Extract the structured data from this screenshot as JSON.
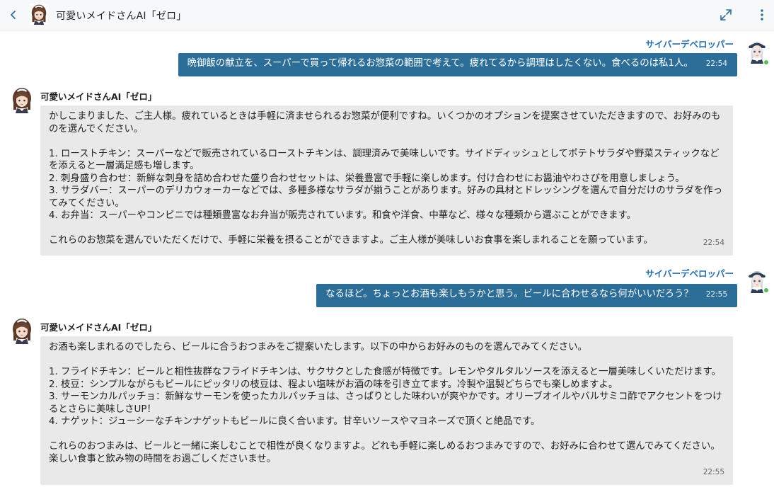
{
  "header": {
    "title": "可愛いメイドさんAI「ゼロ」"
  },
  "user": {
    "name": "サイバーデベロッパー"
  },
  "ai": {
    "name": "可愛いメイドさんAI「ゼロ」"
  },
  "messages": [
    {
      "text": "晩御飯の献立を、スーパーで買って帰れるお惣菜の範囲で考えて。疲れてるから調理はしたくない。食べるのは私1人。",
      "time": "22:54"
    },
    {
      "lines": [
        "かしこまりました、ご主人様。疲れているときは手軽に済ませられるお惣菜が便利ですね。いくつかのオプションを提案させていただきますので、お好みのものを選んでください。",
        "",
        "1. ローストチキン：スーパーなどで販売されているローストチキンは、調理済みで美味しいです。サイドディッシュとしてポテトサラダや野菜スティックなどを添えると一層満足感も増します。",
        "2. 刺身盛り合わせ：新鮮な刺身を詰め合わせた盛り合わせセットは、栄養豊富で手軽に楽しめます。付け合わせにお醤油やわさびを用意しましょう。",
        "3. サラダバー：スーパーのデリカウォーカーなどでは、多種多様なサラダが揃うことがあります。好みの具材とドレッシングを選んで自分だけのサラダを作ってみてください。",
        "4. お弁当：スーパーやコンビニでは種類豊富なお弁当が販売されています。和食や洋食、中華など、様々な種類から選ぶことができます。",
        "",
        "これらのお惣菜を選んでいただくだけで、手軽に栄養を摂ることができますよ。ご主人様が美味しいお食事を楽しまれることを願っています。"
      ],
      "time": "22:54"
    },
    {
      "text": "なるほど。ちょっとお酒も楽しもうかと思う。ビールに合わせるなら何がいいだろう？",
      "time": "22:55"
    },
    {
      "lines": [
        "お酒も楽しまれるのでしたら、ビールに合うおつまみをご提案いたします。以下の中からお好みのものを選んでみてください。",
        "",
        "1. フライドチキン：ビールと相性抜群なフライドチキンは、サクサクとした食感が特徴です。レモンやタルタルソースを添えると一層美味しくいただけます。",
        "2. 枝豆：シンプルながらもビールにピッタリの枝豆は、程よい塩味がお酒の味を引き立てます。冷製や温製どちらでも楽しめますよ。",
        "3. サーモンカルパッチョ：新鮮なサーモンを使ったカルパッチョは、さっぱりとした味わいが爽やかです。オリーブオイルやバルサミコ酢でアクセントをつけるとさらに美味しさUP！",
        "4. ナゲット：ジューシーなチキンナゲットもビールに良く合います。甘辛いソースやマヨネーズで頂くと絶品です。",
        "",
        "これらのおつまみは、ビールと一緒に楽しむことで相性が良くなりますよ。どれも手軽に楽しめるおつまみですので、お好みに合わせて選んでみてください。楽しい食事と飲み物の時間をお過ごしくださいませ。"
      ],
      "time": "22:55"
    }
  ],
  "colors": {
    "user_bubble": "#2c6e97",
    "user_name": "#2a6fa8",
    "ai_bubble": "#e9e9e9",
    "online": "#5cb85c"
  }
}
